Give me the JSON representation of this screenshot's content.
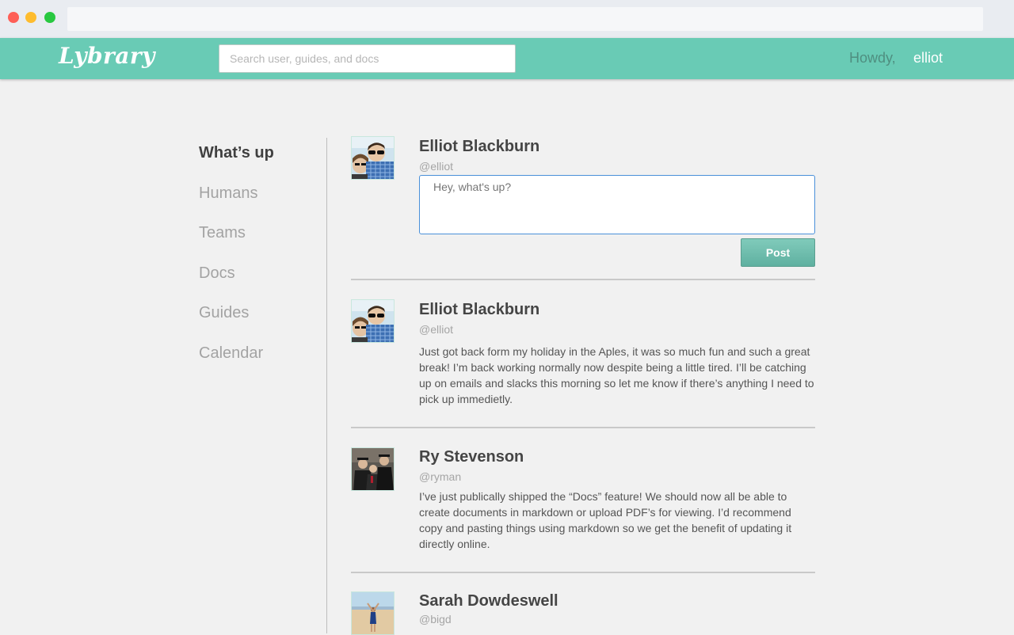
{
  "header": {
    "logo": "Lybrary",
    "search_placeholder": "Search user, guides, and docs",
    "greeting": "Howdy,",
    "username": "elliot"
  },
  "sidebar": {
    "items": [
      {
        "label": "What’s up",
        "active": true
      },
      {
        "label": "Humans"
      },
      {
        "label": "Teams"
      },
      {
        "label": "Docs"
      },
      {
        "label": "Guides"
      },
      {
        "label": "Calendar"
      }
    ]
  },
  "composer": {
    "name": "Elliot Blackburn",
    "handle": "@elliot",
    "placeholder": "Hey, what's up?",
    "post_label": "Post"
  },
  "feed": [
    {
      "name": "Elliot Blackburn",
      "handle": "@elliot",
      "body": "Just got back form my holiday in the Aples, it was so much fun and such a great break! I’m back working normally now despite being a little tired. I’ll be catching up on emails and slacks this morning so let me know if there’s anything I need to pick up immedietly."
    },
    {
      "name": "Ry Stevenson",
      "handle": "@ryman",
      "body": "I’ve just publically shipped the “Docs” feature! We should now all be able to create documents in markdown or upload PDF’s for viewing. I’d recommend copy and pasting things using markdown so we get the benefit of updating it directly online."
    },
    {
      "name": "Sarah Dowdeswell",
      "handle": "@bigd",
      "body": ""
    }
  ],
  "colors": {
    "accent": "#69cbb5",
    "text_dark": "#454545",
    "text_muted": "#a5a5a5"
  }
}
